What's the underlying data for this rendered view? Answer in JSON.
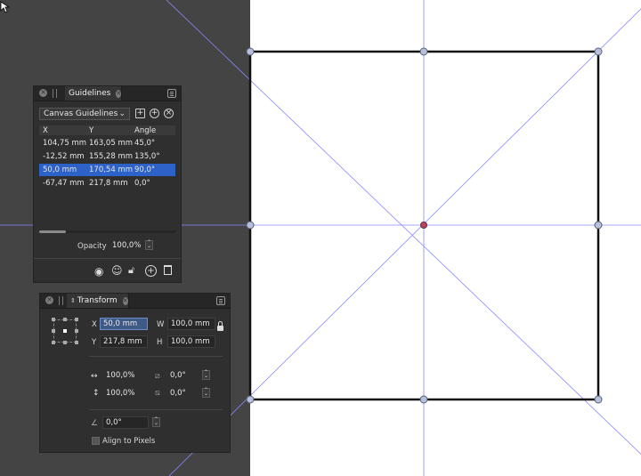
{
  "guidelines_panel": {
    "tab_label": "Guidelines",
    "source_select": "Canvas Guidelines",
    "columns": [
      "X",
      "Y",
      "Angle"
    ],
    "rows": [
      {
        "x": "104,75 mm",
        "y": "163,05 mm",
        "angle": "45,0°",
        "selected": false
      },
      {
        "x": "-12,52 mm",
        "y": "155,28 mm",
        "angle": "135,0°",
        "selected": false
      },
      {
        "x": "50,0 mm",
        "y": "170,54 mm",
        "angle": "90,0°",
        "selected": true
      },
      {
        "x": "-67,47 mm",
        "y": "217,8 mm",
        "angle": "0,0°",
        "selected": false
      }
    ],
    "opacity_label": "Opacity",
    "opacity_value": "100,0%",
    "icons": [
      "add-document-icon",
      "add-circle-icon",
      "close-circle-icon",
      "eye-icon",
      "smiley-icon",
      "unlock-icon",
      "add-icon",
      "trash-icon"
    ]
  },
  "transform_panel": {
    "tab_label": "Transform",
    "x_label": "X",
    "x_value": "50,0 mm",
    "y_label": "Y",
    "y_value": "217,8 mm",
    "w_label": "W",
    "w_value": "100,0 mm",
    "h_label": "H",
    "h_value": "100,0 mm",
    "scale_x": "100,0%",
    "scale_y": "100,0%",
    "shear_x": "0,0°",
    "shear_y": "0,0°",
    "rotation": "0,0°",
    "align_label": "Align to Pixels"
  },
  "colors": {
    "guide": "#8080ff",
    "selection": "#2d63c8",
    "node": "#9aa6c8"
  }
}
